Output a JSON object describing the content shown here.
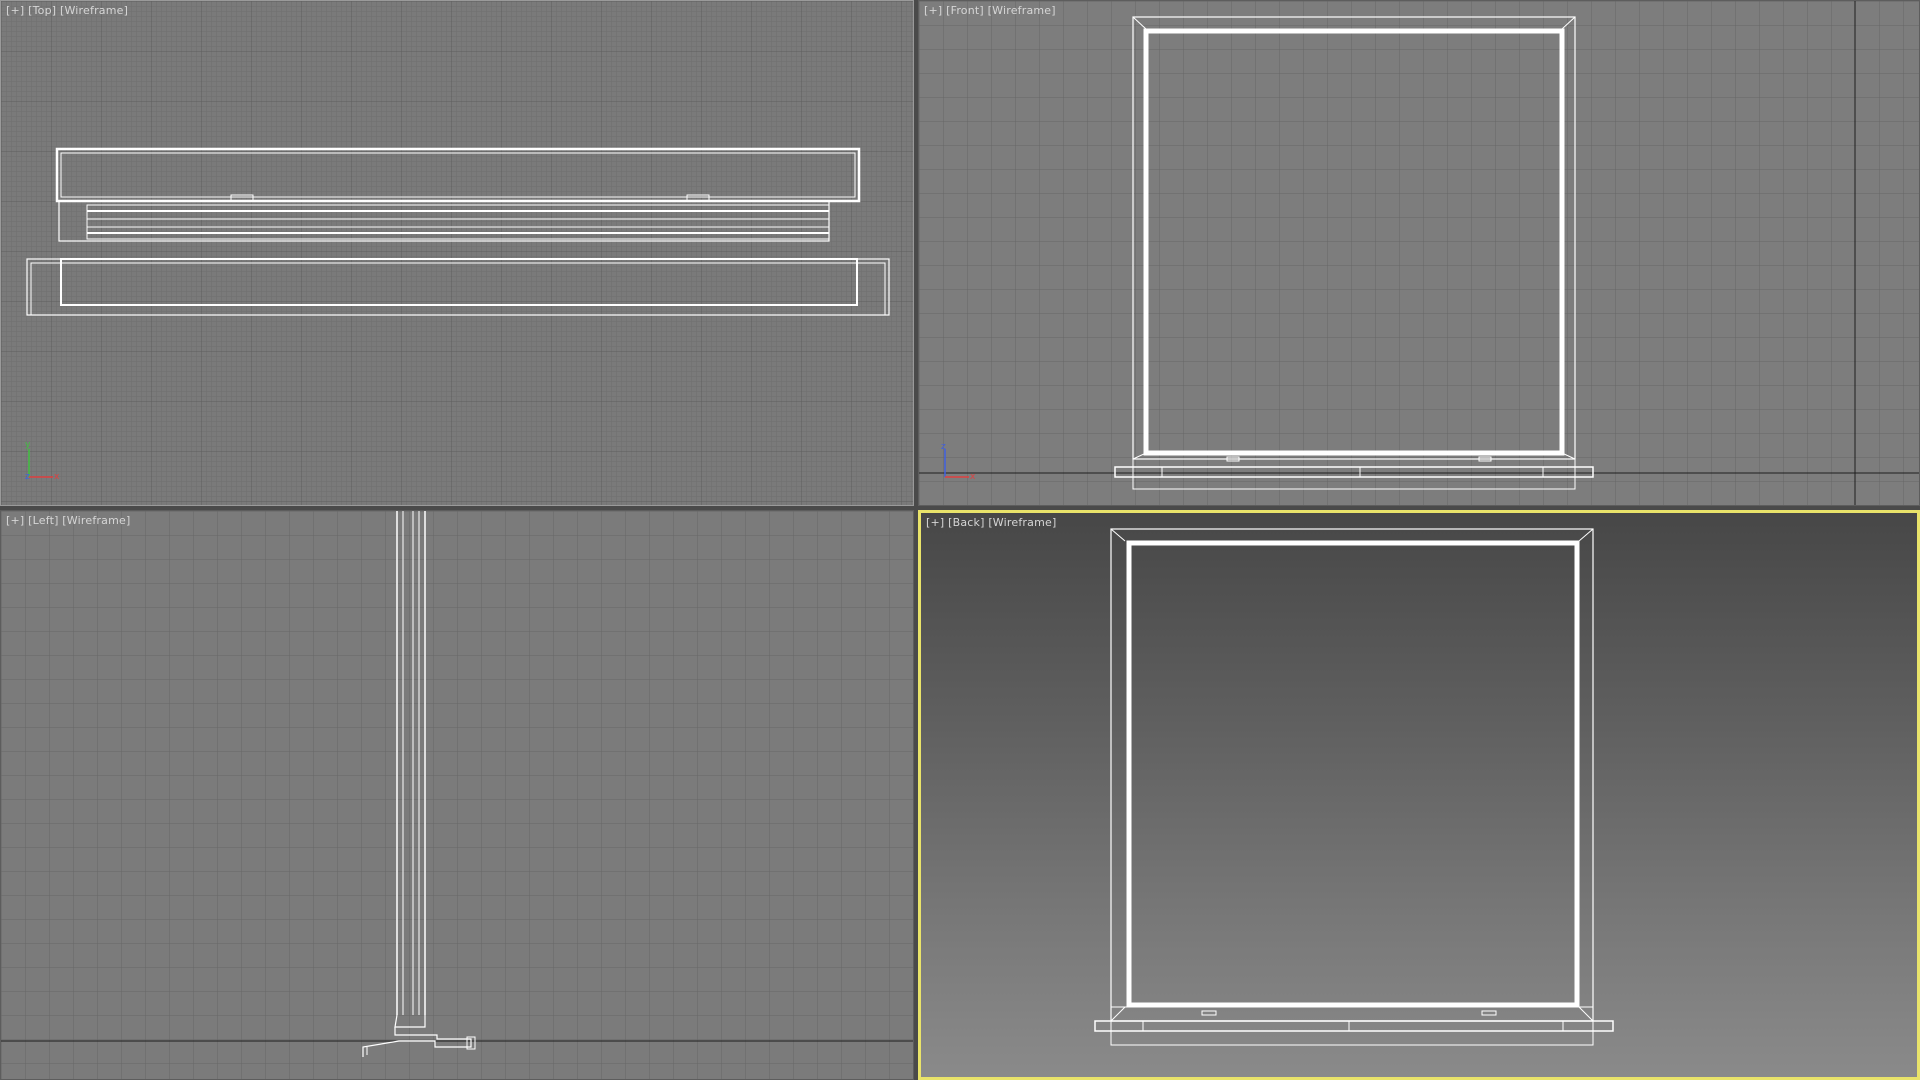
{
  "viewports": {
    "top": {
      "plus": "[+]",
      "view": "[Top]",
      "mode": "[Wireframe]"
    },
    "front": {
      "plus": "[+]",
      "view": "[Front]",
      "mode": "[Wireframe]"
    },
    "left": {
      "plus": "[+]",
      "view": "[Left]",
      "mode": "[Wireframe]"
    },
    "back": {
      "plus": "[+]",
      "view": "[Back]",
      "mode": "[Wireframe]"
    }
  },
  "axis_labels": {
    "x": "x",
    "y": "y",
    "z": "z"
  },
  "active_viewport": "back",
  "colors": {
    "active_border": "#e9e36a",
    "wire": "#ffffff",
    "grid_minor": "#6e6e6e",
    "grid_major": "#5f5f5f",
    "axis_x": "#e04040",
    "axis_y": "#40c040",
    "axis_z": "#4060e0"
  }
}
